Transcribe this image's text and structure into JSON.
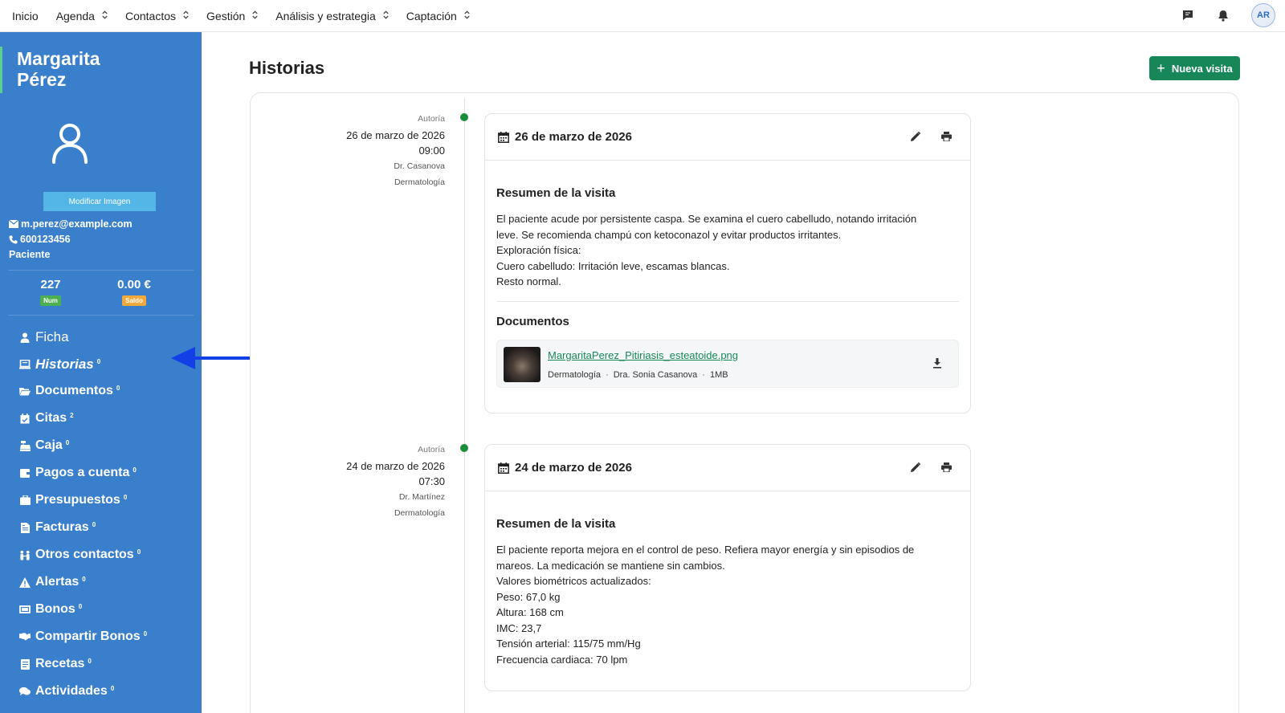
{
  "topnav": {
    "items": [
      {
        "label": "Inicio",
        "dropdown": false
      },
      {
        "label": "Agenda",
        "dropdown": true
      },
      {
        "label": "Contactos",
        "dropdown": true
      },
      {
        "label": "Gestión",
        "dropdown": true
      },
      {
        "label": "Análisis y estrategia",
        "dropdown": true
      },
      {
        "label": "Captación",
        "dropdown": true
      }
    ],
    "icons": [
      "chat-icon",
      "bell-icon"
    ],
    "avatar": "AR"
  },
  "sidebar": {
    "patient_name_line1": "Margarita",
    "patient_name_line2": "Pérez",
    "modify_image_label": "Modificar Imagen",
    "email": "m.perez@example.com",
    "phone": "600123456",
    "role": "Paciente",
    "stats": {
      "num_value": "227",
      "num_label": "Num",
      "saldo_value": "0.00 €",
      "saldo_label": "Saldo",
      "num_color": "#4caf50",
      "saldo_color": "#f0a93a"
    },
    "items": [
      {
        "label": "Ficha",
        "count": "",
        "icon": "user-icon"
      },
      {
        "label": "Historias",
        "count": "0",
        "icon": "laptop-icon",
        "active": true
      },
      {
        "label": "Documentos",
        "count": "0",
        "icon": "folder-icon"
      },
      {
        "label": "Citas",
        "count": "2",
        "icon": "calendar-check-icon"
      },
      {
        "label": "Caja",
        "count": "0",
        "icon": "cash-register-icon"
      },
      {
        "label": "Pagos a cuenta",
        "count": "0",
        "icon": "wallet-icon"
      },
      {
        "label": "Presupuestos",
        "count": "0",
        "icon": "briefcase-icon"
      },
      {
        "label": "Facturas",
        "count": "0",
        "icon": "invoice-icon"
      },
      {
        "label": "Otros contactos",
        "count": "0",
        "icon": "people-icon"
      },
      {
        "label": "Alertas",
        "count": "0",
        "icon": "warning-icon"
      },
      {
        "label": "Bonos",
        "count": "0",
        "icon": "ticket-icon"
      },
      {
        "label": "Compartir Bonos",
        "count": "0",
        "icon": "handshake-icon"
      },
      {
        "label": "Recetas",
        "count": "0",
        "icon": "prescription-icon"
      },
      {
        "label": "Actividades",
        "count": "0",
        "icon": "comments-icon"
      }
    ]
  },
  "main": {
    "title": "Historias",
    "new_visit_label": "Nueva visita",
    "accent_color": "#17875a",
    "visits": [
      {
        "autoria_label": "Autoría",
        "date": "26 de marzo de 2026",
        "time": "09:00",
        "doctor": "Dr. Casanova",
        "specialty": "Dermatología",
        "card_title": "26 de marzo de 2026",
        "summary_title": "Resumen de la visita",
        "summary_lines": [
          "El paciente acude por persistente caspa. Se examina el cuero cabelludo, notando irritación",
          "leve. Se recomienda champú con ketoconazol y evitar productos irritantes.",
          "Exploración física:",
          "Cuero cabelludo: Irritación leve, escamas blancas.",
          "Resto normal."
        ],
        "documents_title": "Documentos",
        "document": {
          "filename": "MargaritaPerez_Pitiriasis_esteatoide.png",
          "specialty": "Dermatología",
          "author": "Dra. Sonia Casanova",
          "size": "1MB"
        }
      },
      {
        "autoria_label": "Autoría",
        "date": "24 de marzo de 2026",
        "time": "07:30",
        "doctor": "Dr. Martínez",
        "specialty": "Dermatología",
        "card_title": "24 de marzo de 2026",
        "summary_title": "Resumen de la visita",
        "summary_lines": [
          "El paciente reporta mejora en el control de peso. Refiera mayor energía y sin episodios de",
          "mareos. La medicación se mantiene sin cambios.",
          "Valores biométricos actualizados:",
          "Peso: 67,0 kg",
          "Altura: 168 cm",
          "IMC: 23,7",
          "Tensión arterial: 115/75 mm/Hg",
          "Frecuencia cardiaca: 70 lpm"
        ]
      }
    ]
  },
  "annotation": {
    "arrow_color": "#1340e6"
  }
}
